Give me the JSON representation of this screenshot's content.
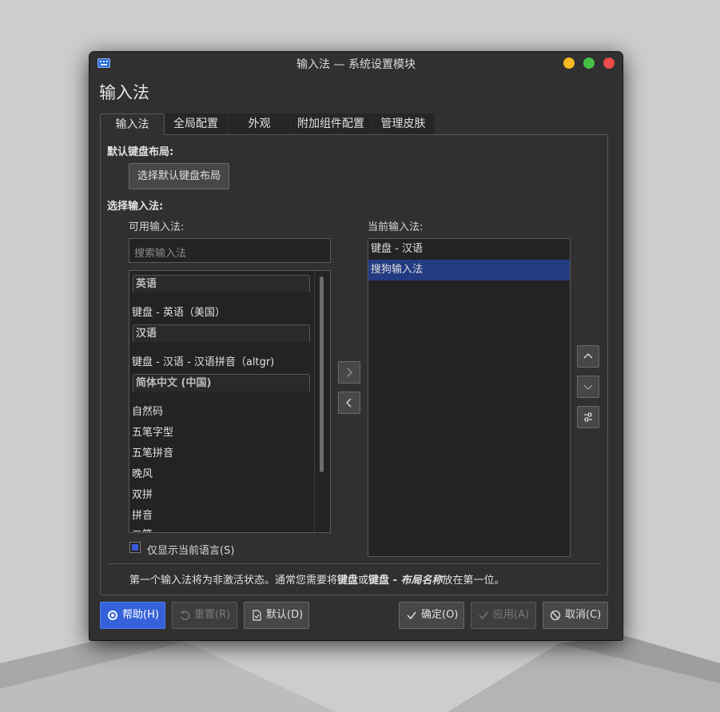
{
  "window": {
    "title": "输入法 — 系统设置模块",
    "page_title": "输入法",
    "controls": {
      "minimize_color": "#f4b824",
      "maximize_color": "#46c147",
      "close_color": "#eb4b4b"
    }
  },
  "tabs": [
    {
      "label": "输入法",
      "active": true
    },
    {
      "label": "全局配置"
    },
    {
      "label": "外观"
    },
    {
      "label": "附加组件配置"
    },
    {
      "label": "管理皮肤"
    }
  ],
  "keyboard": {
    "heading": "默认键盘布局:",
    "select_button": "选择默认键盘布局"
  },
  "im_select": {
    "heading": "选择输入法:",
    "available_label": "可用输入法:",
    "search_placeholder": "搜索输入法",
    "groups": [
      {
        "header": "英语",
        "items": [
          "键盘 - 英语（美国）"
        ]
      },
      {
        "header": "汉语",
        "items": [
          "键盘 - 汉语 - 汉语拼音（altgr)"
        ]
      },
      {
        "header": "简体中文 (中国)",
        "items": [
          "自然码",
          "五笔字型",
          "五笔拼音",
          "晚风",
          "双拼",
          "拼音",
          "二笔"
        ]
      }
    ],
    "current_label": "当前输入法:",
    "current": [
      "键盘 - 汉语",
      "搜狗输入法"
    ],
    "selected_index": 1,
    "only_current_language": "仅显示当前语言(S)",
    "only_current_language_checked": true
  },
  "note": {
    "part1": "第一个输入法将为非激活状态。通常您需要将",
    "bold1": "键盘",
    "part2": "或",
    "bold2": "键盘 - ",
    "bolditalic": "布局名称",
    "part3": "放在第一位。"
  },
  "buttons": {
    "help": "帮助(H)",
    "reset": "重置(R)",
    "defaults": "默认(D)",
    "ok": "确定(O)",
    "apply": "应用(A)",
    "cancel": "取消(C)"
  },
  "accent_color": "#3562d8"
}
